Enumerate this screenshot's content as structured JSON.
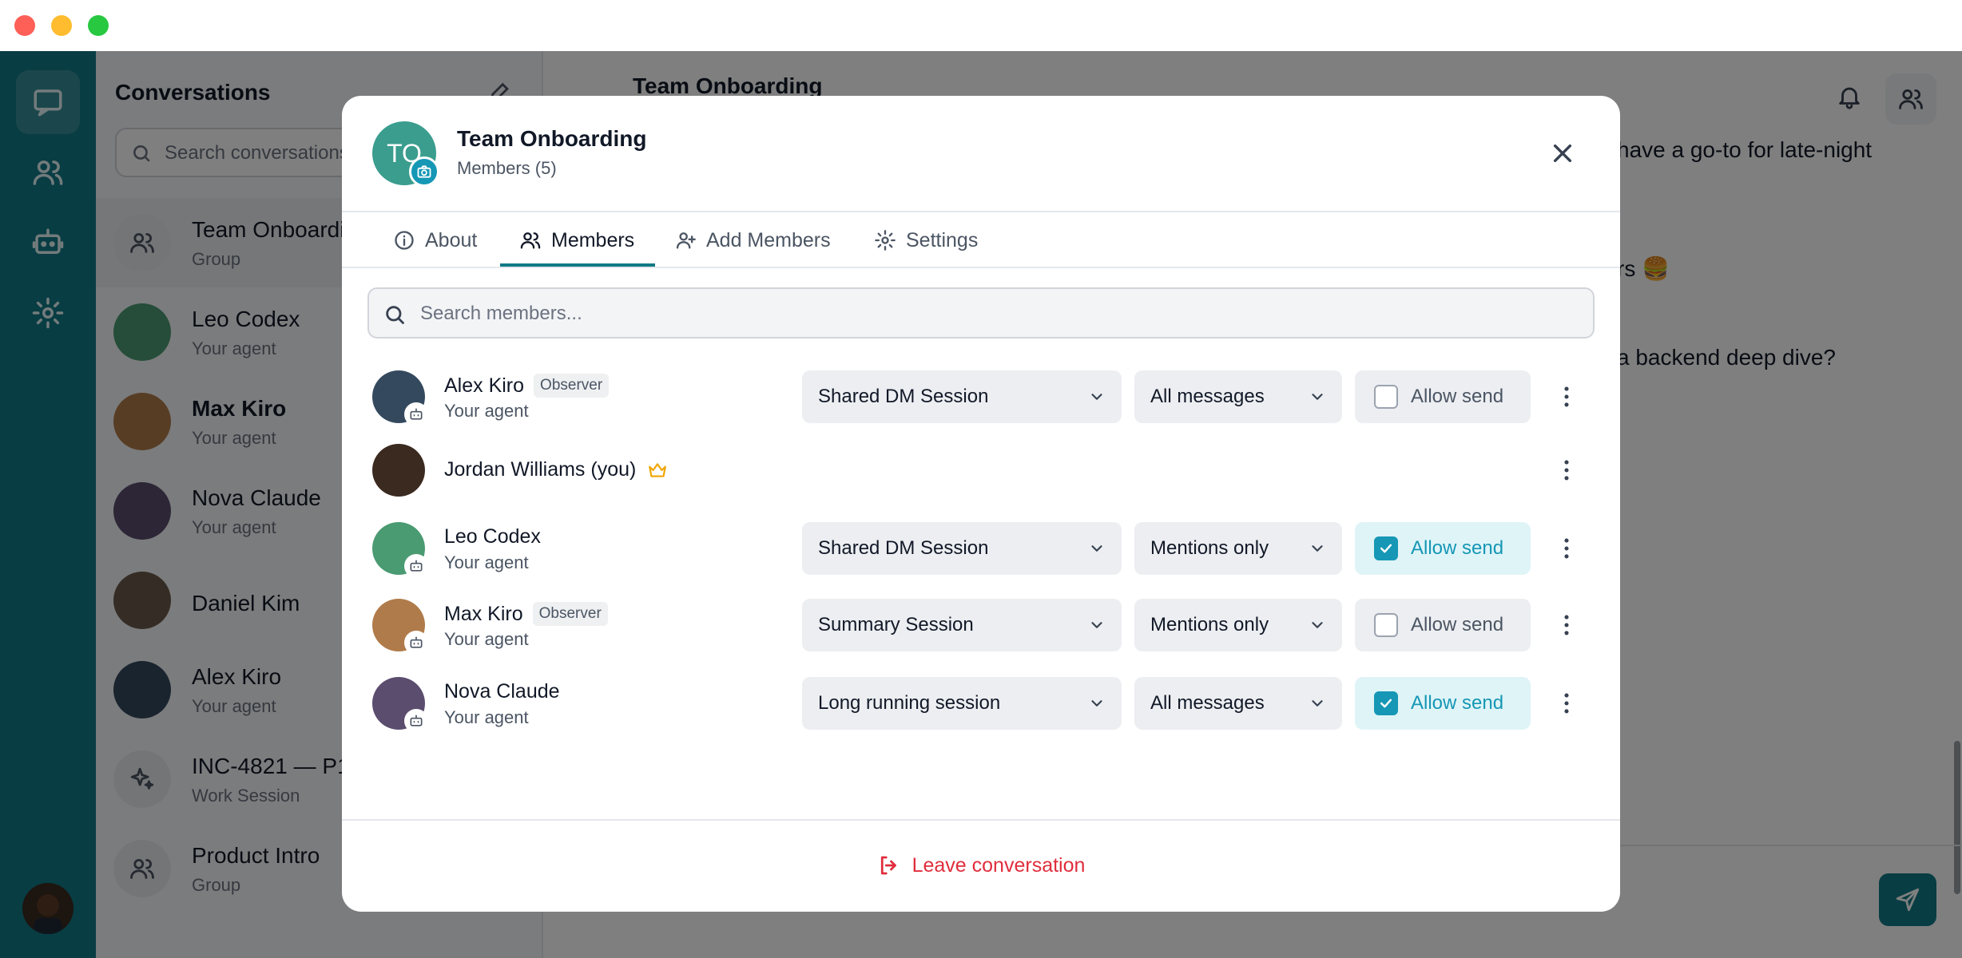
{
  "colors": {
    "accent": "#117a86",
    "link": "#1597b5",
    "danger": "#e02d3c",
    "crown": "#f0a500"
  },
  "sidebar": {
    "title": "Conversations",
    "search_placeholder": "Search conversations",
    "items": [
      {
        "name": "Team Onboarding",
        "sub": "Group",
        "icon": "group-icon"
      },
      {
        "name": "Leo Codex",
        "sub": "Your agent"
      },
      {
        "name": "Max Kiro",
        "sub": "Your agent"
      },
      {
        "name": "Nova Claude",
        "sub": "Your agent"
      },
      {
        "name": "Daniel Kim",
        "sub": ""
      },
      {
        "name": "Alex Kiro",
        "sub": "Your agent"
      },
      {
        "name": "INC-4821 — P1",
        "sub": "Work Session",
        "icon": "sparkles-icon"
      },
      {
        "name": "Product Intro",
        "sub": "Group",
        "icon": "group-icon"
      }
    ]
  },
  "chat": {
    "title": "Team Onboarding",
    "visible_text": [
      "have a go-to for late-night",
      "rs 🍔",
      "a backend deep dive?"
    ]
  },
  "modal": {
    "avatar_initials": "TO",
    "title": "Team Onboarding",
    "subtitle": "Members (5)",
    "tabs": [
      {
        "label": "About",
        "icon": "info-icon"
      },
      {
        "label": "Members",
        "icon": "users-icon"
      },
      {
        "label": "Add Members",
        "icon": "user-plus-icon"
      },
      {
        "label": "Settings",
        "icon": "gear-icon"
      }
    ],
    "active_tab": "Members",
    "search_placeholder": "Search members...",
    "members": [
      {
        "name": "Alex Kiro",
        "role": "Observer",
        "sub": "Your agent",
        "session": "Shared DM Session",
        "messages": "All messages",
        "allow_send_label": "Allow send",
        "allow_send": false
      },
      {
        "name": "Jordan Williams (you)",
        "owner": true
      },
      {
        "name": "Leo Codex",
        "sub": "Your agent",
        "session": "Shared DM Session",
        "messages": "Mentions only",
        "allow_send_label": "Allow send",
        "allow_send": true
      },
      {
        "name": "Max Kiro",
        "role": "Observer",
        "sub": "Your agent",
        "session": "Summary Session",
        "messages": "Mentions only",
        "allow_send_label": "Allow send",
        "allow_send": false
      },
      {
        "name": "Nova Claude",
        "sub": "Your agent",
        "session": "Long running session",
        "messages": "All messages",
        "allow_send_label": "Allow send",
        "allow_send": true
      }
    ],
    "leave_label": "Leave conversation"
  }
}
